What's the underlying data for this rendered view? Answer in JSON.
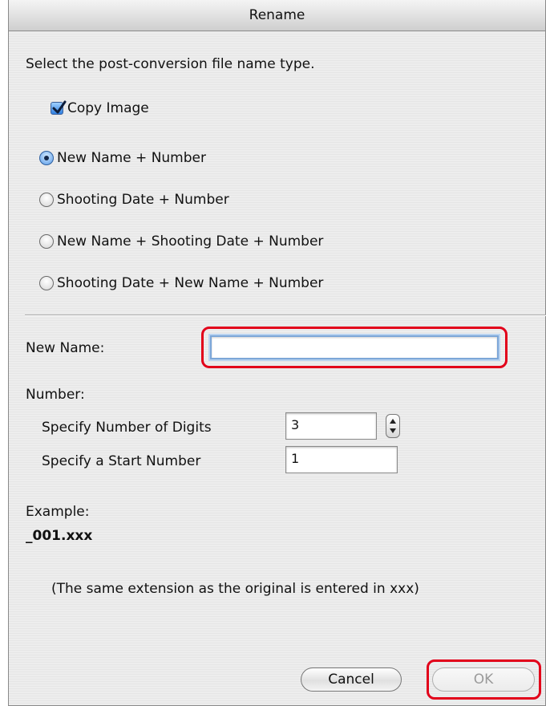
{
  "dialog": {
    "title": "Rename",
    "instruction": "Select the post-conversion file name type.",
    "copy_image": {
      "label": "Copy Image",
      "checked": true
    },
    "name_types": [
      {
        "label": "New Name + Number",
        "selected": true
      },
      {
        "label": "Shooting Date + Number",
        "selected": false
      },
      {
        "label": "New Name + Shooting Date + Number",
        "selected": false
      },
      {
        "label": "Shooting Date + New Name + Number",
        "selected": false
      }
    ],
    "new_name": {
      "label": "New Name:",
      "value": ""
    },
    "number": {
      "label": "Number:",
      "digits_label": "Specify Number of Digits",
      "digits_value": "3",
      "start_label": "Specify a Start Number",
      "start_value": "1"
    },
    "example": {
      "label": "Example:",
      "value": "_001.xxx",
      "note": "(The same extension as the original is entered in xxx)"
    },
    "buttons": {
      "cancel": "Cancel",
      "ok": "OK"
    }
  },
  "colors": {
    "highlight": "#e2001a",
    "focus_ring": "#7ca6d8",
    "accent": "#2f7fe0"
  }
}
